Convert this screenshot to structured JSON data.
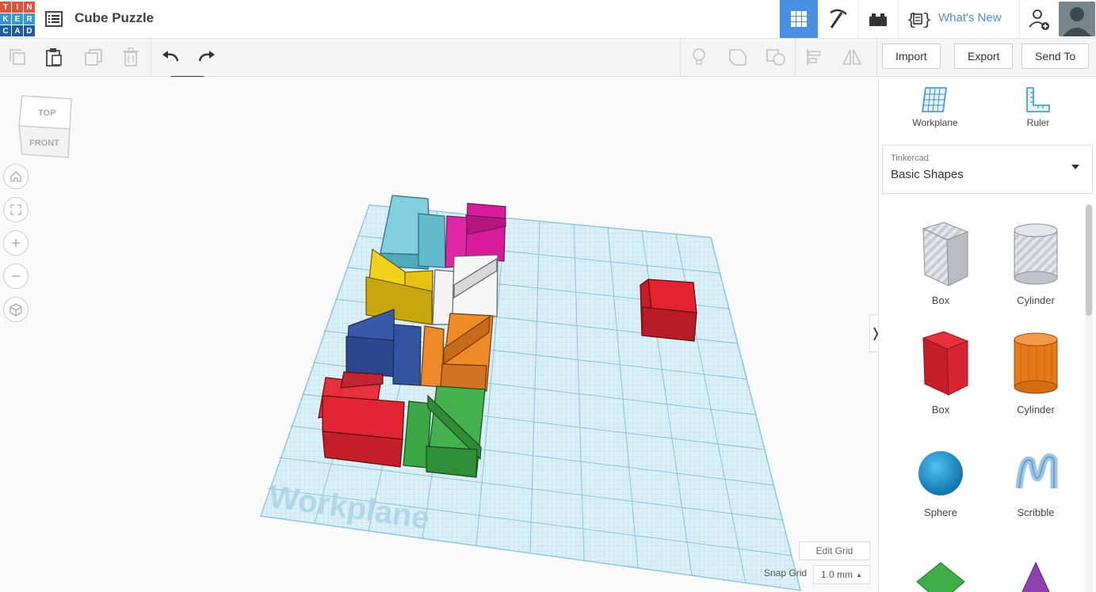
{
  "header": {
    "logo_letters": [
      "T",
      "I",
      "N",
      "K",
      "E",
      "R",
      "C",
      "A",
      "D"
    ],
    "logo_colors": [
      "#e2513b",
      "#e2513b",
      "#e2513b",
      "#2e9ad8",
      "#2e9ad8",
      "#2e9ad8",
      "#1d5c9e",
      "#1d5c9e",
      "#1d5c9e"
    ],
    "title": "Cube Puzzle",
    "whats_new": "What's New",
    "accent": "#4a90e2"
  },
  "toolbar": {
    "tooltip": "icons",
    "import_label": "Import",
    "export_label": "Export",
    "send_to_label": "Send To"
  },
  "viewcube": {
    "top": "TOP",
    "front": "FRONT"
  },
  "viewport": {
    "workplane_label": "Workplane",
    "edit_grid": "Edit Grid",
    "snap_grid_label": "Snap Grid",
    "snap_value": "1.0 mm"
  },
  "panel": {
    "workplane_label": "Workplane",
    "ruler_label": "Ruler",
    "library_small": "Tinkercad",
    "library_name": "Basic Shapes",
    "shapes": [
      {
        "label": "Box"
      },
      {
        "label": "Cylinder"
      },
      {
        "label": "Box"
      },
      {
        "label": "Cylinder"
      },
      {
        "label": "Sphere"
      },
      {
        "label": "Scribble"
      }
    ]
  }
}
